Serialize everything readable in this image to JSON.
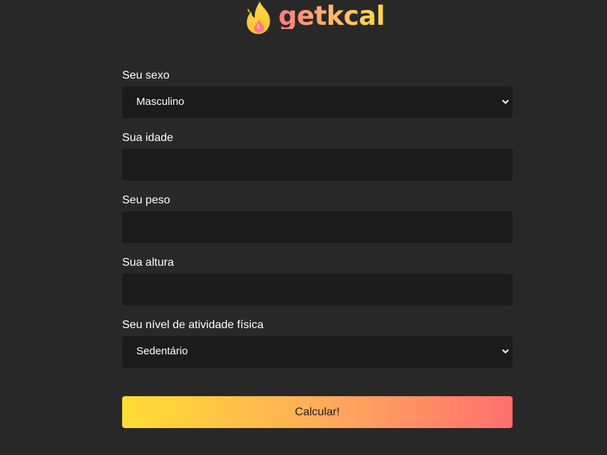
{
  "brand": {
    "name": "getkcal",
    "icon": "flame-icon"
  },
  "form": {
    "sex": {
      "label": "Seu sexo",
      "value": "Masculino"
    },
    "age": {
      "label": "Sua idade",
      "value": ""
    },
    "weight": {
      "label": "Seu peso",
      "value": ""
    },
    "height": {
      "label": "Sua altura",
      "value": ""
    },
    "activity": {
      "label": "Seu nível de atividade física",
      "value": "Sedentário"
    },
    "submit_label": "Calcular!"
  },
  "colors": {
    "background": "#282828",
    "field_background": "#1b1b1b",
    "text": "#ffffff",
    "gradient_start": "#ffde33",
    "gradient_end": "#ff6f6f"
  }
}
